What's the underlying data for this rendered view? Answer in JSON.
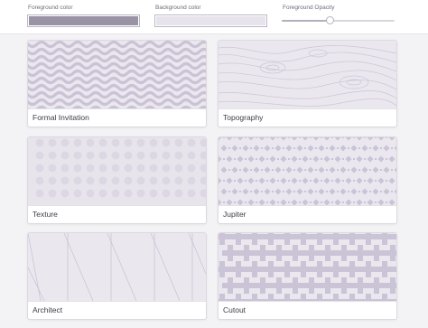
{
  "controls": {
    "foreground_label": "Foreground color",
    "background_label": "Background color",
    "opacity_label": "Foreground Opacity",
    "foreground_color": "#9a93a6",
    "background_color": "#e7e3ec",
    "opacity_value": 0.42
  },
  "patterns": [
    {
      "name": "Formal Invitation",
      "icon": "wave-pattern"
    },
    {
      "name": "Topography",
      "icon": "contour-pattern"
    },
    {
      "name": "Texture",
      "icon": "texture-pattern"
    },
    {
      "name": "Jupiter",
      "icon": "lattice-pattern"
    },
    {
      "name": "Architect",
      "icon": "diagonal-lines-pattern"
    },
    {
      "name": "Cutout",
      "icon": "cross-tile-pattern"
    }
  ],
  "colors": {
    "pattern_bg": "#e9e5ee",
    "pattern_fg": "#c9c2d3"
  }
}
